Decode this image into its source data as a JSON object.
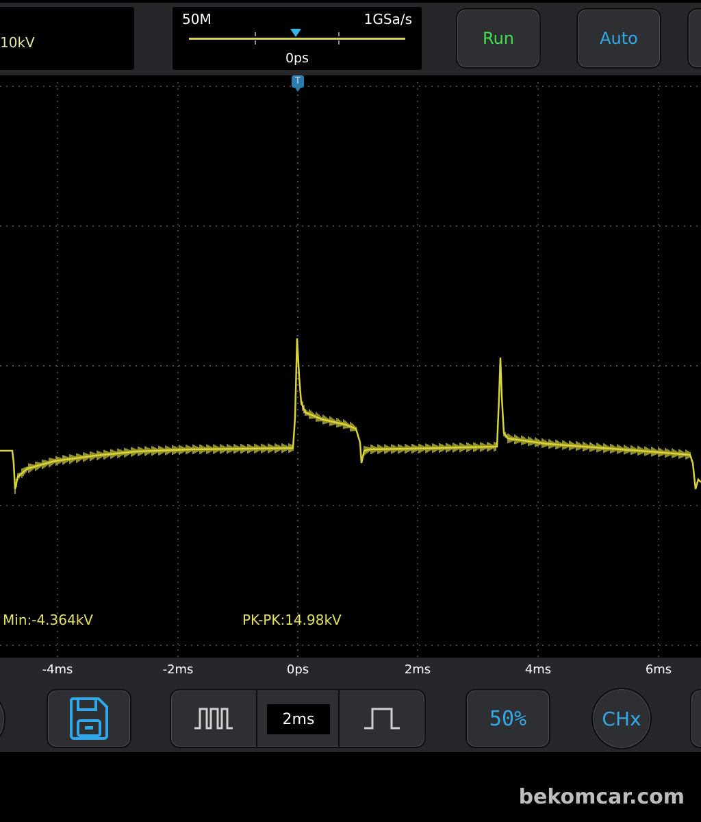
{
  "header": {
    "vertical_scale": "10kV",
    "memory_depth": "50M",
    "sample_rate": "1GSa/s",
    "trigger_position": "0ps",
    "run_label": "Run",
    "auto_label": "Auto",
    "trigger_tag": "T"
  },
  "measurements": {
    "min": "Min:-4.364kV",
    "pkpk": "PK-PK:14.98kV"
  },
  "time_axis": {
    "ticks": [
      "-4ms",
      "-2ms",
      "0ps",
      "2ms",
      "4ms",
      "6ms"
    ]
  },
  "controls": {
    "timebase": "2ms",
    "fifty_label": "50%",
    "channel_label": "CHx"
  },
  "watermark": "bekomcar.com",
  "colors": {
    "trace": "#d8d43a",
    "accent_blue": "#31a8e8",
    "run_green": "#3fe04a",
    "grid": "#6a6a6a"
  },
  "icons": {
    "save": "floppy-disk-icon",
    "zoom_in": "pulse-train-icon",
    "zoom_out": "single-pulse-icon"
  }
}
